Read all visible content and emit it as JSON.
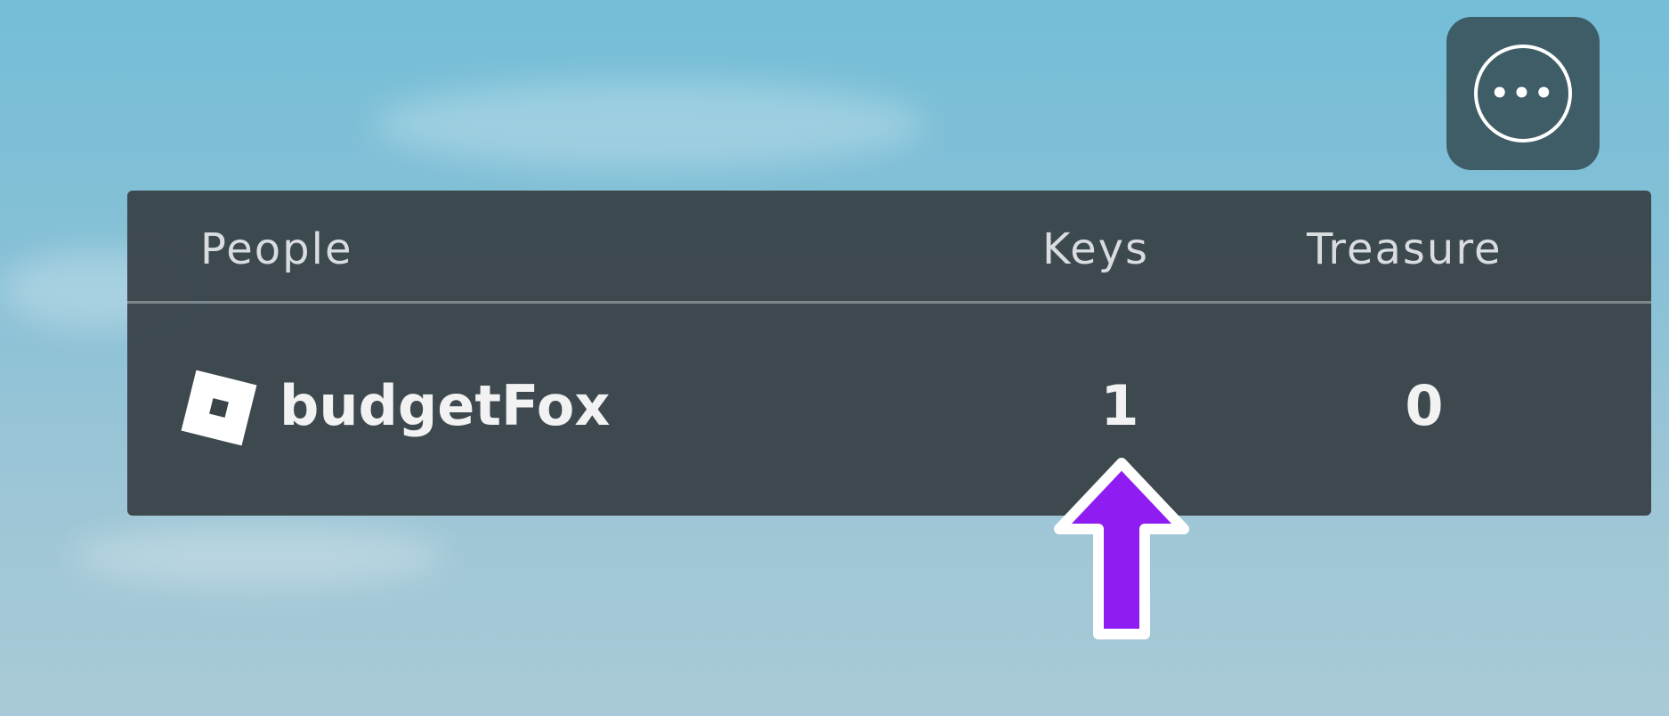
{
  "menu": {
    "icon": "more-options-icon",
    "glyph": "•••"
  },
  "leaderboard": {
    "headers": {
      "people": "People",
      "keys": "Keys",
      "treasure": "Treasure"
    },
    "rows": [
      {
        "icon": "roblox-logo-icon",
        "name": "budgetFox",
        "keys": "1",
        "treasure": "0"
      }
    ]
  },
  "colors": {
    "panel": "#374045",
    "arrow": "#8f1df2",
    "menu_button": "#3f5d66"
  }
}
